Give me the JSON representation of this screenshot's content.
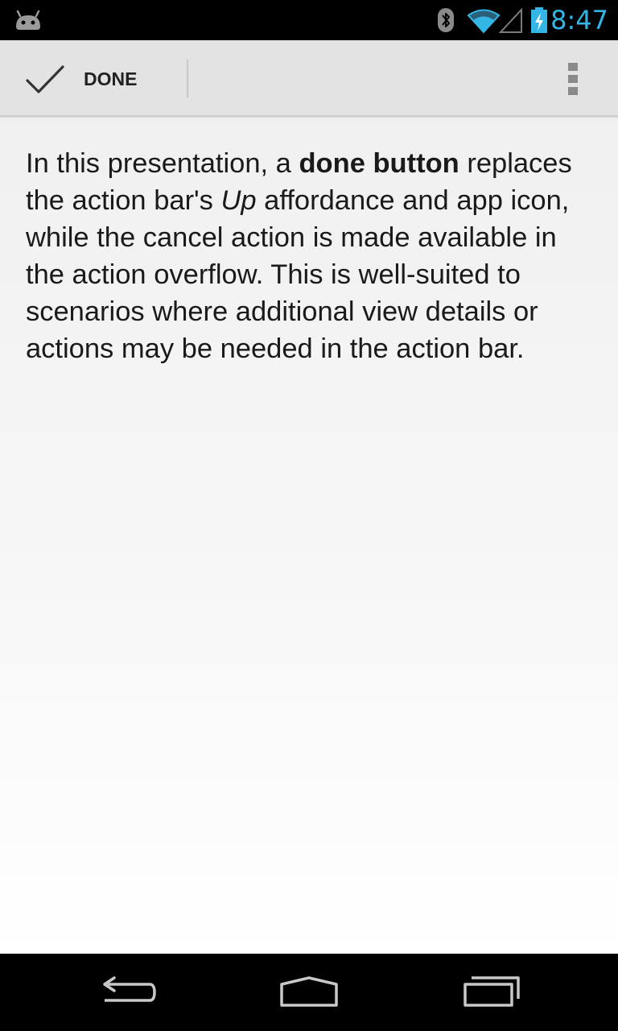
{
  "status_bar": {
    "time": "8:47",
    "icons": [
      "android-notification-icon",
      "bluetooth-icon",
      "wifi-icon",
      "signal-icon",
      "battery-charging-icon"
    ],
    "clock_color": "#33b5e5"
  },
  "action_bar": {
    "done_label": "DONE",
    "done_icon": "check-icon",
    "overflow_icon": "overflow-menu-icon",
    "background": "#e3e3e3"
  },
  "body": {
    "segments": [
      {
        "text": "In this presentation, a ",
        "style": "normal"
      },
      {
        "text": "done button",
        "style": "bold"
      },
      {
        "text": " replaces the action bar's ",
        "style": "normal"
      },
      {
        "text": "Up",
        "style": "italic"
      },
      {
        "text": " affordance and app icon, while the cancel action is made available in the action overflow. This is well-suited to scenarios where additional view details or actions may be needed in the action bar.",
        "style": "normal"
      }
    ]
  },
  "nav_bar": {
    "icons": [
      "back-icon",
      "home-icon",
      "recents-icon"
    ]
  }
}
